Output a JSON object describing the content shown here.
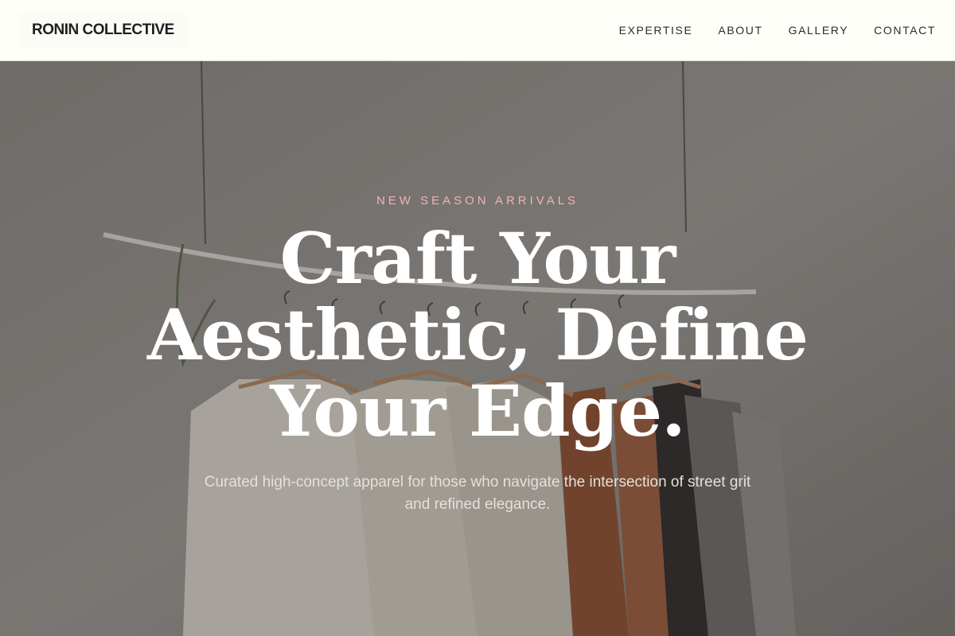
{
  "brand": {
    "name": "RONIN COLLECTIVE"
  },
  "nav": {
    "items": [
      {
        "label": "EXPERTISE"
      },
      {
        "label": "ABOUT"
      },
      {
        "label": "GALLERY"
      },
      {
        "label": "CONTACT"
      }
    ]
  },
  "hero": {
    "eyebrow": "NEW SEASON ARRIVALS",
    "headline": "Craft Your Aesthetic, Define Your Edge.",
    "subtitle": "Curated high-concept apparel for those who navigate the intersection of street grit and refined elegance.",
    "image_subject": "clothing-rack-with-hangers"
  },
  "colors": {
    "header_bg": "#fffffa",
    "eyebrow": "#f2b2b2",
    "headline": "#ffffff",
    "subtitle": "#e4e0da"
  }
}
